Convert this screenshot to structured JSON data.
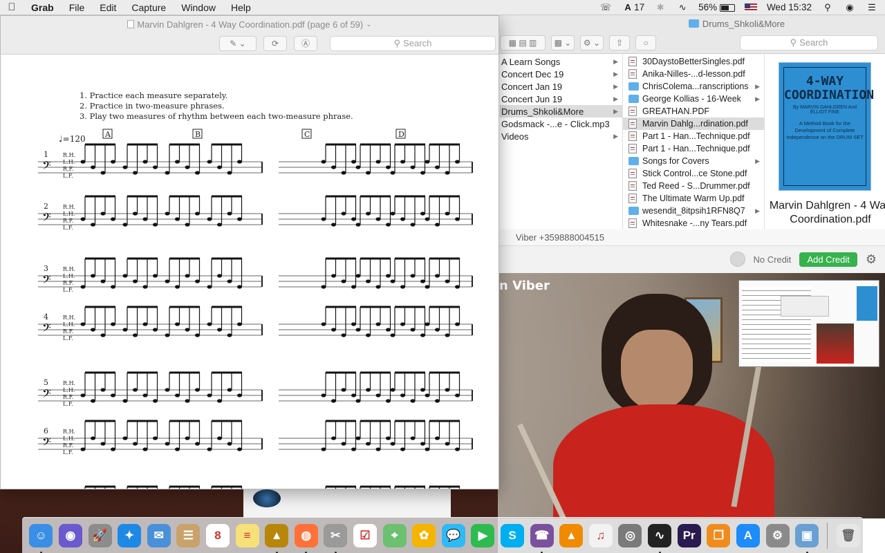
{
  "menubar": {
    "app": "Grab",
    "menus": [
      "File",
      "Edit",
      "Capture",
      "Window",
      "Help"
    ],
    "status": {
      "adobe_count": "17",
      "battery": "56%",
      "clock": "Wed 15:32"
    }
  },
  "preview": {
    "title": "Marvin Dahlgren - 4 Way Coordination.pdf (page 6 of 59)",
    "search_placeholder": "Search",
    "instructions": [
      "1.  Practice each measure separately.",
      "2.  Practice in two-measure phrases.",
      "3.  Play two measures of rhythm between each two-measure phrase."
    ],
    "tempo": "♩=120",
    "section_letters": [
      "A",
      "B",
      "C",
      "D"
    ],
    "voice_labels": [
      "R.H.",
      "L.H.",
      "R.F.",
      "L.F."
    ],
    "exercise_numbers": [
      "1",
      "2",
      "3",
      "4",
      "5",
      "6"
    ]
  },
  "finder": {
    "title": "Drums_Shkoli&More",
    "search_placeholder": "Search",
    "column1": [
      {
        "label": "A Learn Songs",
        "arrow": true
      },
      {
        "label": "Concert Dec 19",
        "arrow": true
      },
      {
        "label": "Concert Jan 19",
        "arrow": true
      },
      {
        "label": "Concert Jun 19",
        "arrow": true
      },
      {
        "label": "Drums_Shkoli&More",
        "arrow": true,
        "selected": true
      },
      {
        "label": "Godsmack -...e - Click.mp3",
        "arrow": false
      },
      {
        "label": "Videos",
        "arrow": true
      }
    ],
    "column2": [
      {
        "label": "30DaystoBetterSingles.pdf",
        "kind": "file"
      },
      {
        "label": "Anika-Nilles-...d-lesson.pdf",
        "kind": "file"
      },
      {
        "label": "ChrisColema...ranscriptions",
        "kind": "folder"
      },
      {
        "label": "George Kollias - 16-Week",
        "kind": "folder"
      },
      {
        "label": "GREATHAN.PDF",
        "kind": "file"
      },
      {
        "label": "Marvin Dahlg...rdination.pdf",
        "kind": "file",
        "selected": true
      },
      {
        "label": "Part 1 - Han...Technique.pdf",
        "kind": "file"
      },
      {
        "label": "Part 1 - Han...Technique.pdf",
        "kind": "file"
      },
      {
        "label": "Songs for Covers",
        "kind": "folder"
      },
      {
        "label": "Stick Control...ce Stone.pdf",
        "kind": "file"
      },
      {
        "label": "Ted Reed - S...Drummer.pdf",
        "kind": "file"
      },
      {
        "label": "The Ultimate Warm Up.pdf",
        "kind": "file"
      },
      {
        "label": "wesendit_8itpsih1RFN8Q7",
        "kind": "folder"
      },
      {
        "label": "Whitesnake -...ny Tears.pdf",
        "kind": "file"
      }
    ],
    "preview_cover": {
      "title": "4-WAY COORDINATION",
      "by": "By MARVIN DAHLGREN And ELLIOT FINE",
      "subtitle": "A Method Book for the Development of Complete Independence on the DRUM SET"
    },
    "preview_name": "Marvin Dahlgren - 4 Way Coordination.pdf"
  },
  "viber": {
    "title": "Viber +359888004515",
    "credit_status": "No Credit",
    "add_credit": "Add Credit",
    "video_label": "n Viber"
  },
  "dock": {
    "apps": [
      {
        "name": "finder-icon",
        "color": "#3a8ee6",
        "glyph": "☺",
        "running": true
      },
      {
        "name": "siri-icon",
        "color": "#6a5acd",
        "glyph": "◉",
        "running": false
      },
      {
        "name": "launchpad-icon",
        "color": "#8c8c8c",
        "glyph": "🚀",
        "running": false
      },
      {
        "name": "safari-icon",
        "color": "#1e88e5",
        "glyph": "✦",
        "running": false
      },
      {
        "name": "mail-icon",
        "color": "#4a90d9",
        "glyph": "✉",
        "running": false
      },
      {
        "name": "contacts-icon",
        "color": "#c9a26b",
        "glyph": "☰",
        "running": false
      },
      {
        "name": "calendar-icon",
        "color": "#ffffff",
        "glyph": "8",
        "running": false
      },
      {
        "name": "notes-icon",
        "color": "#f7e07a",
        "glyph": "≡",
        "running": false
      },
      {
        "name": "metronome-icon",
        "color": "#b8860b",
        "glyph": "▲",
        "running": true
      },
      {
        "name": "firefox-icon",
        "color": "#ff7139",
        "glyph": "◍",
        "running": true
      },
      {
        "name": "grab-icon",
        "color": "#9a9a9a",
        "glyph": "✂",
        "running": true
      },
      {
        "name": "reminders-icon",
        "color": "#ffffff",
        "glyph": "☑",
        "running": false
      },
      {
        "name": "maps-icon",
        "color": "#6cc070",
        "glyph": "⌖",
        "running": false
      },
      {
        "name": "photos-icon",
        "color": "#f4b400",
        "glyph": "✿",
        "running": false
      },
      {
        "name": "messages-icon",
        "color": "#2fb9f5",
        "glyph": "💬",
        "running": false
      },
      {
        "name": "facetime-icon",
        "color": "#2dbb4f",
        "glyph": "▶",
        "running": false
      },
      {
        "name": "skype-icon",
        "color": "#00aff0",
        "glyph": "S",
        "running": false
      },
      {
        "name": "viber-icon",
        "color": "#7b519d",
        "glyph": "☎",
        "running": true
      },
      {
        "name": "vlc-icon",
        "color": "#f08a00",
        "glyph": "▲",
        "running": false
      },
      {
        "name": "itunes-icon",
        "color": "#f2f2f2",
        "glyph": "♫",
        "running": false
      },
      {
        "name": "disk-utility-icon",
        "color": "#7a7a7a",
        "glyph": "◎",
        "running": false
      },
      {
        "name": "activity-monitor-icon",
        "color": "#222222",
        "glyph": "∿",
        "running": true
      },
      {
        "name": "premiere-icon",
        "color": "#2a1a4f",
        "glyph": "Pr",
        "running": false
      },
      {
        "name": "books-icon",
        "color": "#f08c1e",
        "glyph": "❐",
        "running": false
      },
      {
        "name": "app-store-icon",
        "color": "#1d8cf8",
        "glyph": "A",
        "running": false
      },
      {
        "name": "system-preferences-icon",
        "color": "#8a8a8a",
        "glyph": "⚙",
        "running": false
      },
      {
        "name": "preview-icon",
        "color": "#6a9fd4",
        "glyph": "▣",
        "running": true
      }
    ],
    "trash": {
      "name": "trash-icon",
      "glyph": "🗑"
    }
  }
}
